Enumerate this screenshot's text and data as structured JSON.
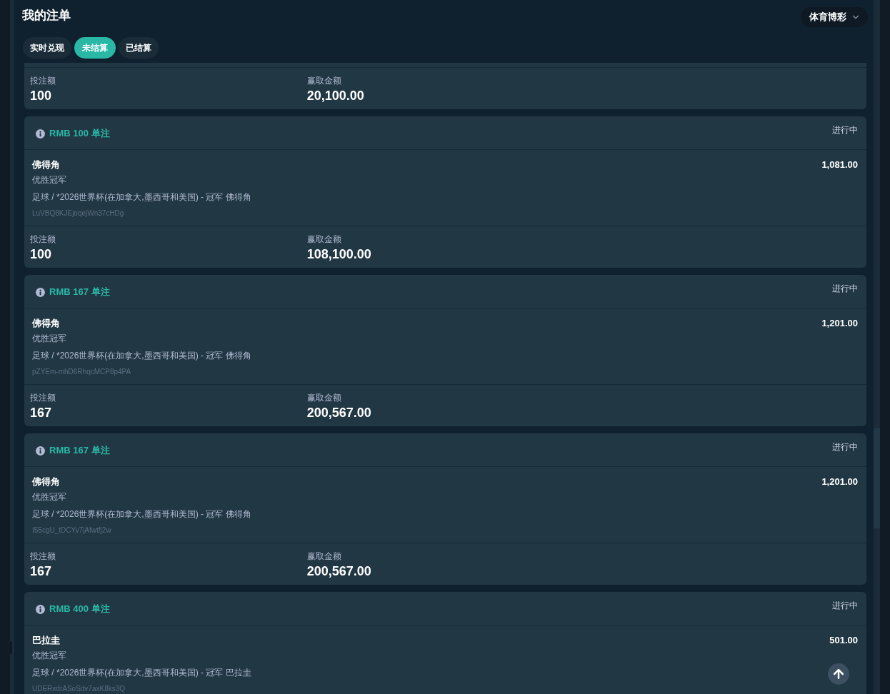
{
  "page": {
    "title": "我的注单"
  },
  "product_selector": {
    "value": "体育博彩"
  },
  "tabs": [
    {
      "label": "实时兑现",
      "selected": false
    },
    {
      "label": "未结算",
      "selected": true
    },
    {
      "label": "已结算",
      "selected": false
    }
  ],
  "bets": [
    {
      "stake_label": "投注额",
      "stake": "100",
      "payout_label": "赢取金额",
      "payout": "20,100.00"
    },
    {
      "title": "RMB 100 单注",
      "status": "进行中",
      "selection": "佛得角",
      "market": "优胜冠军",
      "event": "足球 / *2026世界杯(在加拿大,墨西哥和美国) - 冠军 佛得角",
      "odds": "1,081.00",
      "bet_id": "LuVBQ8KJEjoqejWn37cHDg",
      "stake_label": "投注额",
      "stake": "100",
      "payout_label": "赢取金额",
      "payout": "108,100.00"
    },
    {
      "title": "RMB 167 单注",
      "status": "进行中",
      "selection": "佛得角",
      "market": "优胜冠军",
      "event": "足球 / *2026世界杯(在加拿大,墨西哥和美国) - 冠军 佛得角",
      "odds": "1,201.00",
      "bet_id": "pZYEm-mhD6RhqcMCP8p4PA",
      "stake_label": "投注额",
      "stake": "167",
      "payout_label": "赢取金额",
      "payout": "200,567.00"
    },
    {
      "title": "RMB 167 单注",
      "status": "进行中",
      "selection": "佛得角",
      "market": "优胜冠军",
      "event": "足球 / *2026世界杯(在加拿大,墨西哥和美国) - 冠军 佛得角",
      "odds": "1,201.00",
      "bet_id": "I55cgU_tDCYv7jAfwtfj2w",
      "stake_label": "投注额",
      "stake": "167",
      "payout_label": "赢取金额",
      "payout": "200,567.00"
    },
    {
      "title": "RMB 400 单注",
      "status": "进行中",
      "selection": "巴拉圭",
      "market": "优胜冠军",
      "event": "足球 / *2026世界杯(在加拿大,墨西哥和美国) - 冠军 巴拉圭",
      "odds": "501.00",
      "bet_id": "UDERxdrASoSdv7axK8ks3Q"
    }
  ]
}
